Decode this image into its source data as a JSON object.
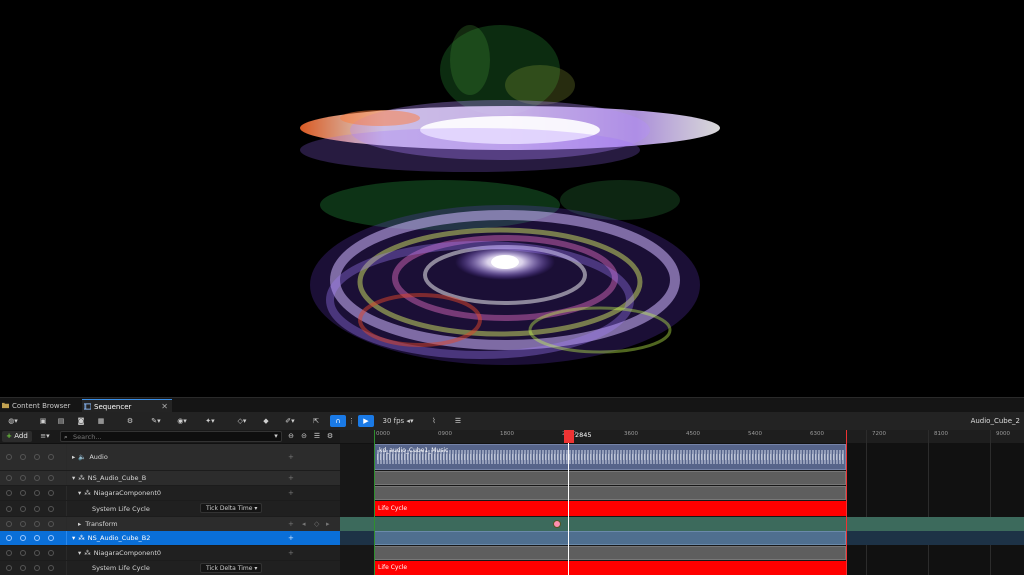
{
  "tabs": [
    {
      "label": "Content Browser",
      "active": false
    },
    {
      "label": "Sequencer",
      "active": true,
      "close": "✕"
    }
  ],
  "toolbar": {
    "fps_label": "30 fps",
    "sequence_name": "Audio_Cube_2"
  },
  "outliner": {
    "add_label": "Add",
    "search_placeholder": "Search...",
    "rows": [
      {
        "label": "Audio",
        "type": "folder"
      },
      {
        "label": "NS_Audio_Cube_B",
        "type": "actor"
      },
      {
        "label": "NiagaraComponent0",
        "type": "component"
      },
      {
        "label": "System Life Cycle",
        "type": "property",
        "dropdown": "Tick Delta Time"
      },
      {
        "label": "Transform",
        "type": "transform"
      },
      {
        "label": "NS_Audio_Cube_B2",
        "type": "actor",
        "selected": true
      },
      {
        "label": "NiagaraComponent0",
        "type": "component"
      },
      {
        "label": "System Life Cycle",
        "type": "property",
        "dropdown": "Tick Delta Time"
      }
    ]
  },
  "timeline": {
    "ticks": [
      "0000",
      "0900",
      "1800",
      "2700",
      "3600",
      "4500",
      "5400",
      "6300",
      "7200",
      "8100",
      "9000"
    ],
    "playhead_label": "2845",
    "audio_clip_label": "kd_audio_Cube1_Music",
    "lifecycle_label": "Life Cycle"
  },
  "colors": {
    "accent": "#1a7ae6",
    "selected_row": "#0a6fd8",
    "lifecycle": "#ff0000",
    "audio_clip": "#5a6a90",
    "transform_track": "#3c6a5c"
  }
}
